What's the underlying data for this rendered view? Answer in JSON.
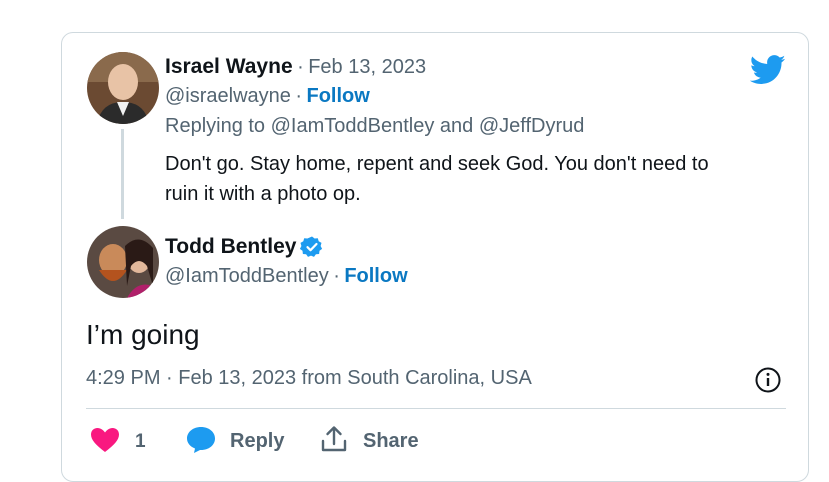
{
  "parent_tweet": {
    "author_name": "Israel Wayne",
    "separator": "·",
    "date": "Feb 13, 2023",
    "handle": "@israelwayne",
    "follow_label": "Follow",
    "replying_prefix": "Replying to",
    "replying_user_1": "@IamToddBentley",
    "replying_and": "and",
    "replying_user_2": "@JeffDyrud",
    "text_line_1": "Don't go. Stay home, repent and seek God. You don't need to",
    "text_line_2": "ruin it with a photo op."
  },
  "main_tweet": {
    "author_name": "Todd Bentley",
    "verified": true,
    "handle": "@IamToddBentley",
    "separator": "·",
    "follow_label": "Follow",
    "text": "I’m going",
    "meta": "4:29 PM · Feb 13, 2023 from South Carolina, USA"
  },
  "actions": {
    "like_count": "1",
    "reply_label": "Reply",
    "share_label": "Share"
  },
  "icons": {
    "brand": "twitter-bird-icon",
    "info": "info-icon",
    "like": "heart-icon",
    "reply": "speech-bubble-icon",
    "share": "share-icon",
    "verified": "verified-badge-icon"
  },
  "colors": {
    "twitter_blue": "#1d9bf0",
    "follow_blue": "#0a78c2",
    "like_pink": "#f91880",
    "muted": "#536471",
    "border": "#cfd9de"
  }
}
